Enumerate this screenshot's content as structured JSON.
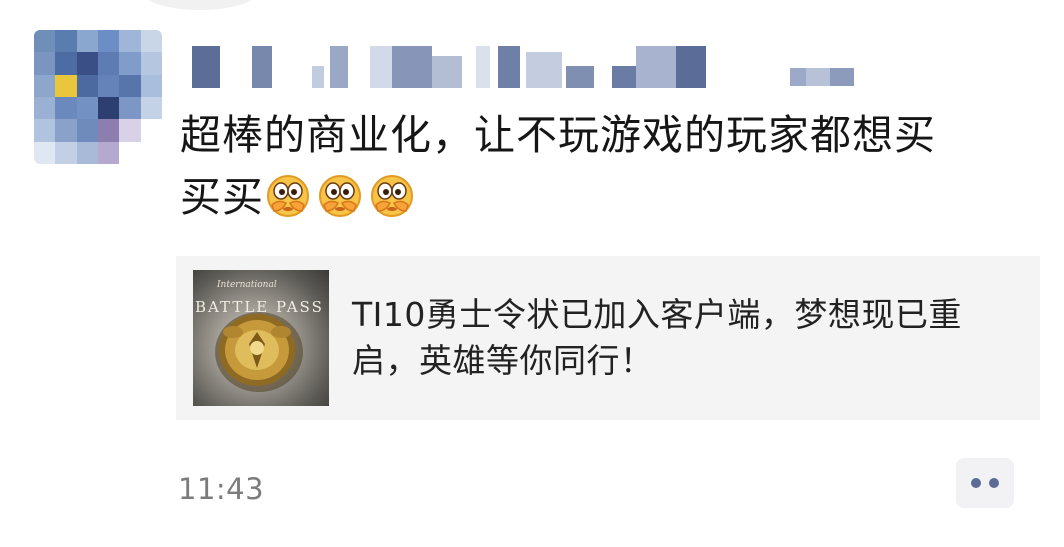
{
  "post": {
    "text_line1": "超棒的商业化，让不玩游戏的玩家都想买",
    "text_line2": "买买",
    "emojis": [
      "facepalm-peek-emoji",
      "facepalm-peek-emoji",
      "facepalm-peek-emoji"
    ]
  },
  "link_card": {
    "thumbnail_label": "BATTLE PASS",
    "thumbnail_sub": "International",
    "title": "TI10勇士令状已加入客户端，梦想现已重启，英雄等你同行！"
  },
  "footer": {
    "time": "11:43",
    "more_icon": "two-dots-icon"
  },
  "colors": {
    "more_dots": "#5b6b96",
    "card_bg": "#f4f4f4",
    "timestamp": "#7c7c7c"
  }
}
